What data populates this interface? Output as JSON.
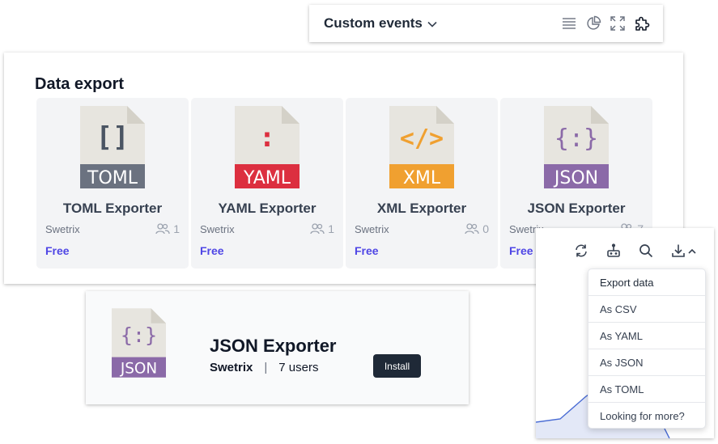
{
  "custom_events": {
    "title": "Custom events",
    "icons": [
      "list-icon",
      "pie-chart-icon",
      "fullscreen-icon",
      "puzzle-icon"
    ]
  },
  "data_export": {
    "title": "Data export",
    "tiles": [
      {
        "name": "TOML Exporter",
        "author": "Swetrix",
        "users": "1",
        "price": "Free",
        "badge": "TOML",
        "glyph": "[]",
        "badge_color": "#6b7280",
        "glyph_color": "#4b5563"
      },
      {
        "name": "YAML Exporter",
        "author": "Swetrix",
        "users": "1",
        "price": "Free",
        "badge": "YAML",
        "glyph": ":",
        "badge_color": "#dc2f3f",
        "glyph_color": "#dc2f3f"
      },
      {
        "name": "XML Exporter",
        "author": "Swetrix",
        "users": "0",
        "price": "Free",
        "badge": "XML",
        "glyph": "</>",
        "badge_color": "#f0a030",
        "glyph_color": "#f0a030"
      },
      {
        "name": "JSON Exporter",
        "author": "Swetrix",
        "users": "7",
        "price": "Free",
        "badge": "JSON",
        "glyph": "{:}",
        "badge_color": "#8b6aa8",
        "glyph_color": "#8b6aa8"
      }
    ]
  },
  "json_detail": {
    "name": "JSON Exporter",
    "author": "Swetrix",
    "separator": "|",
    "users_label": "7 users",
    "install_label": "Install",
    "badge": "JSON",
    "glyph": "{:}",
    "badge_color": "#8b6aa8"
  },
  "chart_toolbar": {
    "icons": [
      "refresh-icon",
      "segment-icon",
      "search-icon",
      "download-icon",
      "chevron-up-icon"
    ]
  },
  "export_menu": {
    "header": "Export data",
    "items": [
      "As CSV",
      "As YAML",
      "As JSON",
      "As TOML",
      "Looking for more?"
    ]
  }
}
